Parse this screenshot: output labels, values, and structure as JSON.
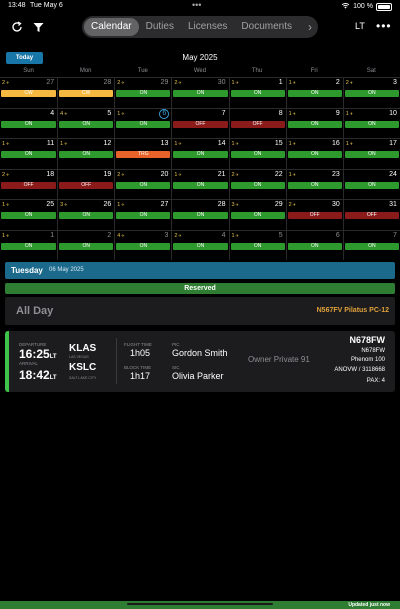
{
  "status_bar": {
    "time": "13:48",
    "date": "Tue May 6",
    "battery": "100 %"
  },
  "toolbar": {
    "tabs": [
      {
        "label": "Calendar",
        "active": true
      },
      {
        "label": "Duties",
        "active": false
      },
      {
        "label": "Licenses",
        "active": false
      },
      {
        "label": "Documents",
        "active": false
      }
    ],
    "timezone_label": "LT"
  },
  "calendar": {
    "today_label": "Today",
    "month_title": "May 2025",
    "weekdays": [
      "Sun",
      "Mon",
      "Tue",
      "Wed",
      "Thu",
      "Fri",
      "Sat"
    ],
    "weeks": [
      [
        {
          "num": "27",
          "count": "2",
          "muted": true,
          "status": "CW",
          "color": "#f5b942"
        },
        {
          "num": "28",
          "count": "",
          "muted": true,
          "status": "CW",
          "color": "#f5b942"
        },
        {
          "num": "29",
          "count": "2",
          "muted": true,
          "status": "ON",
          "color": "#2e9a2e"
        },
        {
          "num": "30",
          "count": "2",
          "muted": true,
          "status": "ON",
          "color": "#2e9a2e"
        },
        {
          "num": "1",
          "count": "1",
          "muted": false,
          "status": "ON",
          "color": "#2e9a2e"
        },
        {
          "num": "2",
          "count": "1",
          "muted": false,
          "status": "ON",
          "color": "#2e9a2e"
        },
        {
          "num": "3",
          "count": "2",
          "muted": false,
          "status": "ON",
          "color": "#2e9a2e"
        }
      ],
      [
        {
          "num": "4",
          "count": "",
          "muted": false,
          "status": "ON",
          "color": "#2e9a2e"
        },
        {
          "num": "5",
          "count": "4",
          "muted": false,
          "status": "ON",
          "color": "#2e9a2e"
        },
        {
          "num": "6",
          "count": "1",
          "muted": false,
          "status": "ON",
          "color": "#2e9a2e",
          "today": true
        },
        {
          "num": "7",
          "count": "",
          "muted": false,
          "status": "OFF",
          "color": "#8b1a1a"
        },
        {
          "num": "8",
          "count": "",
          "muted": false,
          "status": "OFF",
          "color": "#8b1a1a"
        },
        {
          "num": "9",
          "count": "1",
          "muted": false,
          "status": "ON",
          "color": "#2e9a2e"
        },
        {
          "num": "10",
          "count": "1",
          "muted": false,
          "status": "ON",
          "color": "#2e9a2e"
        }
      ],
      [
        {
          "num": "11",
          "count": "1",
          "muted": false,
          "status": "ON",
          "color": "#2e9a2e"
        },
        {
          "num": "12",
          "count": "1",
          "muted": false,
          "status": "ON",
          "color": "#2e9a2e"
        },
        {
          "num": "13",
          "count": "",
          "muted": false,
          "status": "TRG",
          "color": "#e8632a"
        },
        {
          "num": "14",
          "count": "1",
          "muted": false,
          "status": "ON",
          "color": "#2e9a2e"
        },
        {
          "num": "15",
          "count": "1",
          "muted": false,
          "status": "ON",
          "color": "#2e9a2e"
        },
        {
          "num": "16",
          "count": "1",
          "muted": false,
          "status": "ON",
          "color": "#2e9a2e"
        },
        {
          "num": "17",
          "count": "1",
          "muted": false,
          "status": "ON",
          "color": "#2e9a2e"
        }
      ],
      [
        {
          "num": "18",
          "count": "2",
          "muted": false,
          "status": "OFF",
          "color": "#8b1a1a"
        },
        {
          "num": "19",
          "count": "",
          "muted": false,
          "status": "OFF",
          "color": "#8b1a1a"
        },
        {
          "num": "20",
          "count": "2",
          "muted": false,
          "status": "ON",
          "color": "#2e9a2e"
        },
        {
          "num": "21",
          "count": "1",
          "muted": false,
          "status": "ON",
          "color": "#2e9a2e"
        },
        {
          "num": "22",
          "count": "2",
          "muted": false,
          "status": "ON",
          "color": "#2e9a2e"
        },
        {
          "num": "23",
          "count": "1",
          "muted": false,
          "status": "ON",
          "color": "#2e9a2e"
        },
        {
          "num": "24",
          "count": "",
          "muted": false,
          "status": "ON",
          "color": "#2e9a2e"
        }
      ],
      [
        {
          "num": "25",
          "count": "1",
          "muted": false,
          "status": "ON",
          "color": "#2e9a2e"
        },
        {
          "num": "26",
          "count": "3",
          "muted": false,
          "status": "ON",
          "color": "#2e9a2e"
        },
        {
          "num": "27",
          "count": "1",
          "muted": false,
          "status": "ON",
          "color": "#2e9a2e"
        },
        {
          "num": "28",
          "count": "",
          "muted": false,
          "status": "ON",
          "color": "#2e9a2e"
        },
        {
          "num": "29",
          "count": "3",
          "muted": false,
          "status": "ON",
          "color": "#2e9a2e"
        },
        {
          "num": "30",
          "count": "2",
          "muted": false,
          "status": "OFF",
          "color": "#8b1a1a"
        },
        {
          "num": "31",
          "count": "",
          "muted": false,
          "status": "OFF",
          "color": "#8b1a1a"
        }
      ],
      [
        {
          "num": "1",
          "count": "1",
          "muted": true,
          "status": "ON",
          "color": "#2e9a2e"
        },
        {
          "num": "2",
          "count": "",
          "muted": true,
          "status": "ON",
          "color": "#2e9a2e"
        },
        {
          "num": "3",
          "count": "4",
          "muted": true,
          "status": "ON",
          "color": "#2e9a2e"
        },
        {
          "num": "4",
          "count": "2",
          "muted": true,
          "status": "ON",
          "color": "#2e9a2e"
        },
        {
          "num": "5",
          "count": "1",
          "muted": true,
          "status": "ON",
          "color": "#2e9a2e"
        },
        {
          "num": "6",
          "count": "",
          "muted": true,
          "status": "ON",
          "color": "#2e9a2e"
        },
        {
          "num": "7",
          "count": "",
          "muted": true,
          "status": "ON",
          "color": "#2e9a2e"
        }
      ]
    ]
  },
  "selected": {
    "day_name": "Tuesday",
    "date": "06 May 2025",
    "reserved_label": "Reserved",
    "all_day_label": "All Day",
    "all_day_aircraft": "N567FV Pilatus PC-12"
  },
  "flight": {
    "departure_label": "DEPARTURE",
    "departure_time": "16:25",
    "arrival_label": "ARRIVAL",
    "arrival_time": "18:42",
    "lt_suffix": "LT",
    "origin_code": "KLAS",
    "origin_city": "LAS VEGAS",
    "dest_code": "KSLC",
    "dest_city": "SALT LAKE CITY",
    "flight_time_label": "FLIGHT TIME",
    "flight_time": "1h05",
    "block_time_label": "BLOCK TIME",
    "block_time": "1h17",
    "pic_label": "PIC",
    "pic_name": "Gordon Smith",
    "sic_label": "SIC",
    "sic_name": "Olivia Parker",
    "owner": "Owner Private 91",
    "tail": "N678FW",
    "tail_sub": "N678FW",
    "aircraft_type": "Phenom 100",
    "ref": "ANOVW / 3118668",
    "pax": "PAX: 4"
  },
  "footer": {
    "updated_text": "Updated just now"
  },
  "colors": {
    "accent": "#1976a8",
    "on": "#2e9a2e",
    "off": "#8b1a1a",
    "trg": "#e8632a",
    "cw": "#f5b942",
    "reserved": "#2e7d32",
    "aircraft": "#e0a13a"
  }
}
